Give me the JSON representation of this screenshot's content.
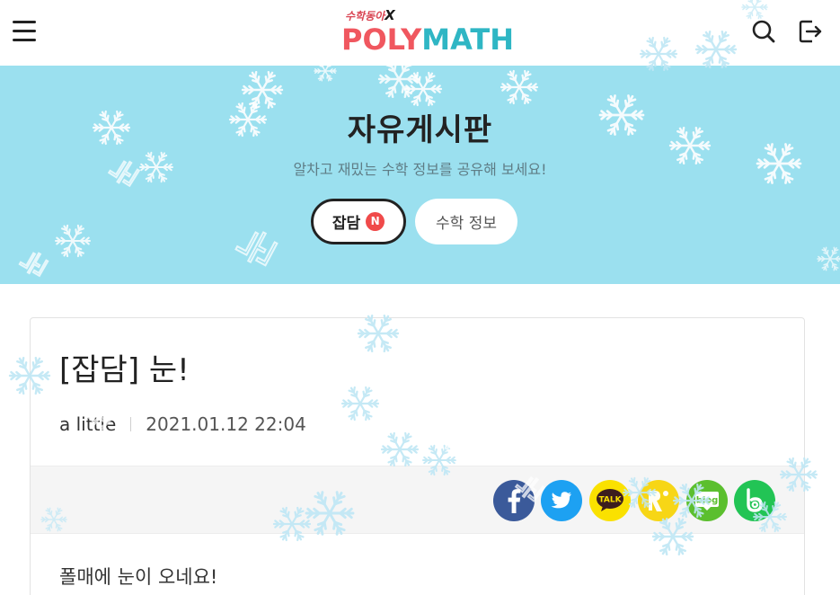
{
  "header": {
    "logo_top": "수학동아",
    "logo_top_x": "X",
    "logo_poly": "POLY",
    "logo_math": "MATH"
  },
  "hero": {
    "title": "자유게시판",
    "subtitle": "알차고 재밌는 수학 정보를 공유해 보세요!",
    "tabs": [
      {
        "label": "잡담",
        "badge": "N",
        "active": true
      },
      {
        "label": "수학 정보",
        "active": false
      }
    ]
  },
  "post": {
    "title": "[잡담] 눈!",
    "author": "a little",
    "date": "2021.01.12 22:04",
    "body": "폴매에 눈이 오네요!"
  },
  "share": {
    "facebook_icon": "facebook-icon",
    "twitter_icon": "twitter-icon",
    "kakaotalk_label": "TALK",
    "kakaostory_icon": "kakaostory-icon",
    "blog_label": "blog",
    "band_label": "b"
  },
  "colors": {
    "hero_bg": "#9be0ef",
    "logo_poly": "#f0575f",
    "logo_math": "#2fb6c4",
    "badge": "#f04a4a",
    "facebook": "#3b5a9a",
    "twitter": "#1da1f2",
    "kakaotalk": "#fae100",
    "kakaostory": "#f7d616",
    "blog": "#5bbf2e",
    "band": "#22c455"
  },
  "snow_word": "눈"
}
